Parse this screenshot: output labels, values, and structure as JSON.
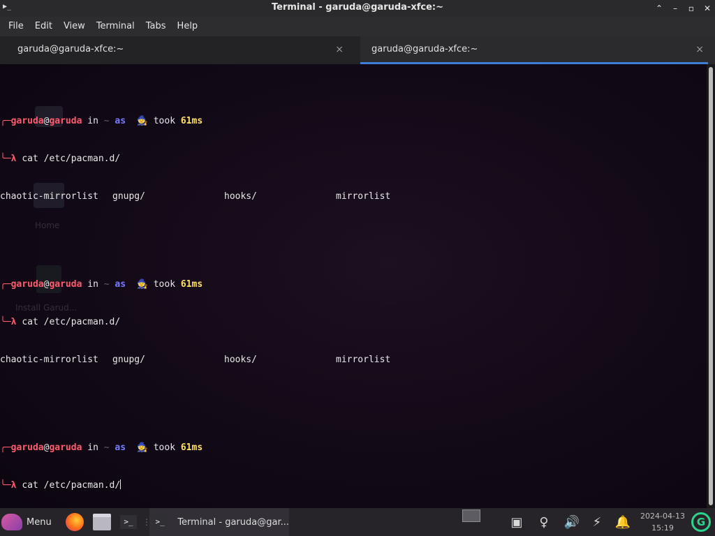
{
  "window": {
    "title": "Terminal - garuda@garuda-xfce:~",
    "controls": {
      "up": "⌃",
      "minimize": "–",
      "maximize": "▫",
      "close": "✕"
    }
  },
  "menubar": [
    "File",
    "Edit",
    "View",
    "Terminal",
    "Tabs",
    "Help"
  ],
  "tabs": [
    {
      "label": "garuda@garuda-xfce:~",
      "active": false,
      "close": "×"
    },
    {
      "label": "garuda@garuda-xfce:~",
      "active": true,
      "close": "×"
    }
  ],
  "terminal": {
    "blocks": [
      {
        "user": "garuda",
        "at": "@",
        "host": "garuda",
        "in": " in ",
        "dir": "~",
        "as": " as ",
        "icon": "🧙",
        "took": " took ",
        "time": "61ms",
        "command": "cat /etc/pacman.d/",
        "output": [
          "chaotic-mirrorlist",
          "gnupg/",
          "hooks/",
          "mirrorlist"
        ]
      },
      {
        "user": "garuda",
        "at": "@",
        "host": "garuda",
        "in": " in ",
        "dir": "~",
        "as": " as ",
        "icon": "🧙",
        "took": " took ",
        "time": "61ms",
        "command": "cat /etc/pacman.d/",
        "output": [
          "chaotic-mirrorlist",
          "gnupg/",
          "hooks/",
          "mirrorlist"
        ]
      },
      {
        "user": "garuda",
        "at": "@",
        "host": "garuda",
        "in": " in ",
        "dir": "~",
        "as": " as ",
        "icon": "🧙",
        "took": " took ",
        "time": "61ms",
        "command": "cat /etc/pacman.d/"
      }
    ],
    "prompt_top": "╭─",
    "prompt_bottom": "╰─λ "
  },
  "desktop": {
    "home_label": "Home",
    "install_label": "Install Garud..."
  },
  "taskbar": {
    "start_label": "Menu",
    "task_label": "Terminal - garuda@gar...",
    "date": "2024-04-13",
    "time": "15:19",
    "garuda_glyph": "G"
  },
  "colors": {
    "accent": "#3d7fd6",
    "prompt_red": "#ff5b6e",
    "prompt_blue": "#7a7cff",
    "prompt_yellow": "#ffe066",
    "garuda_green": "#2bd48c"
  }
}
